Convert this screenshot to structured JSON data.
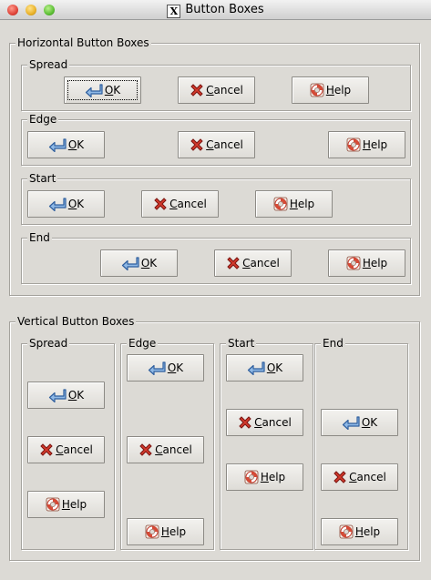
{
  "window": {
    "title": "Button Boxes"
  },
  "horizontal": {
    "title": "Horizontal Button Boxes",
    "spread": {
      "label": "Spread"
    },
    "edge": {
      "label": "Edge"
    },
    "start": {
      "label": "Start"
    },
    "end": {
      "label": "End"
    }
  },
  "vertical": {
    "title": "Vertical Button Boxes",
    "spread": {
      "label": "Spread"
    },
    "edge": {
      "label": "Edge"
    },
    "start": {
      "label": "Start"
    },
    "end": {
      "label": "End"
    }
  },
  "buttons": {
    "ok": {
      "mnemonic": "O",
      "rest": "K"
    },
    "cancel": {
      "mnemonic": "C",
      "rest": "ancel"
    },
    "help": {
      "mnemonic": "H",
      "rest": "elp"
    }
  },
  "icons": {
    "ok": "ok-arrow-icon",
    "cancel": "red-x-icon",
    "help": "lifebuoy-icon"
  },
  "colors": {
    "ok_icon": "#4a86c8",
    "cancel_icon": "#cc2a22",
    "help_icon": "#d8503c"
  }
}
